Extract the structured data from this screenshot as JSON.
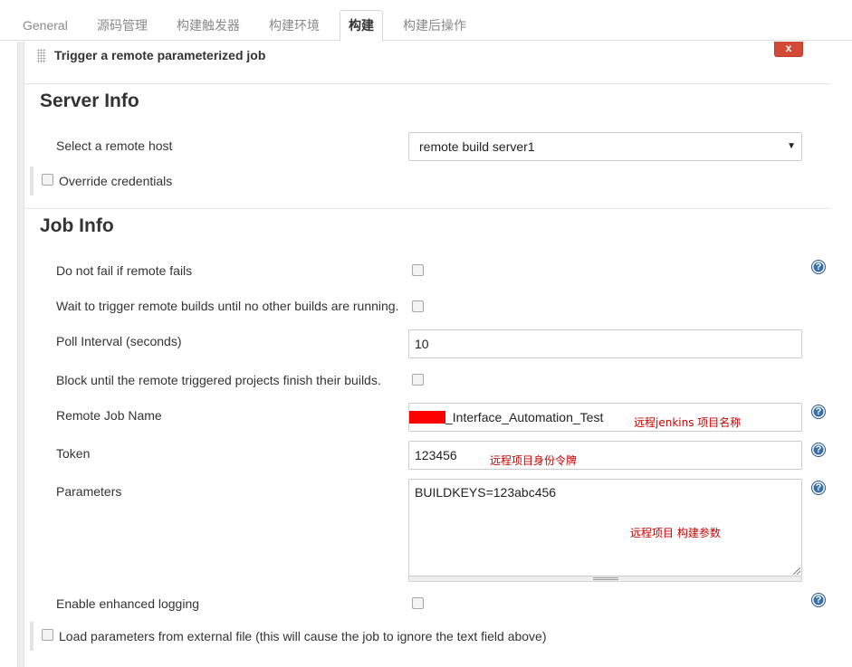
{
  "tabs": [
    {
      "label": "General",
      "active": false
    },
    {
      "label": "源码管理",
      "active": false
    },
    {
      "label": "构建触发器",
      "active": false
    },
    {
      "label": "构建环境",
      "active": false
    },
    {
      "label": "构建",
      "active": true
    },
    {
      "label": "构建后操作",
      "active": false
    }
  ],
  "builder": {
    "title": "Trigger a remote parameterized job",
    "delete_label": "x"
  },
  "server_info": {
    "heading": "Server Info",
    "remote_host_label": "Select a remote host",
    "remote_host_value": "remote build server1",
    "override_credentials_label": "Override credentials",
    "override_credentials_checked": false
  },
  "job_info": {
    "heading": "Job Info",
    "do_not_fail_label": "Do not fail if remote fails",
    "do_not_fail_checked": false,
    "wait_trigger_label": "Wait to trigger remote builds until no other builds are running.",
    "wait_trigger_checked": false,
    "poll_interval_label": "Poll Interval (seconds)",
    "poll_interval_value": "10",
    "block_until_label": "Block until the remote triggered projects finish their builds.",
    "block_until_checked": false,
    "remote_job_name_label": "Remote Job Name",
    "remote_job_name_value": "_Interface_Automation_Test",
    "token_label": "Token",
    "token_value": "123456",
    "parameters_label": "Parameters",
    "parameters_value": "BUILDKEYS=123abc456",
    "enhanced_logging_label": "Enable enhanced logging",
    "enhanced_logging_checked": false,
    "load_params_label": "Load parameters from external file (this will cause the job to ignore the text field above)",
    "load_params_checked": false
  },
  "help_icon_glyph": "?",
  "annotations": {
    "job_name_note": "远程jenkins 项目名称",
    "token_note": "远程项目身份令牌",
    "params_note": "远程项目  构建参数"
  },
  "colors": {
    "annotation_red": "#cc0000",
    "delete_button": "#d24a36",
    "help_icon": "#3a6ea5",
    "redaction": "#ff0000"
  },
  "icons": [
    "drag-handle-icon",
    "close-icon",
    "help-icon",
    "dropdown-caret-icon",
    "resize-grip-icon"
  ]
}
